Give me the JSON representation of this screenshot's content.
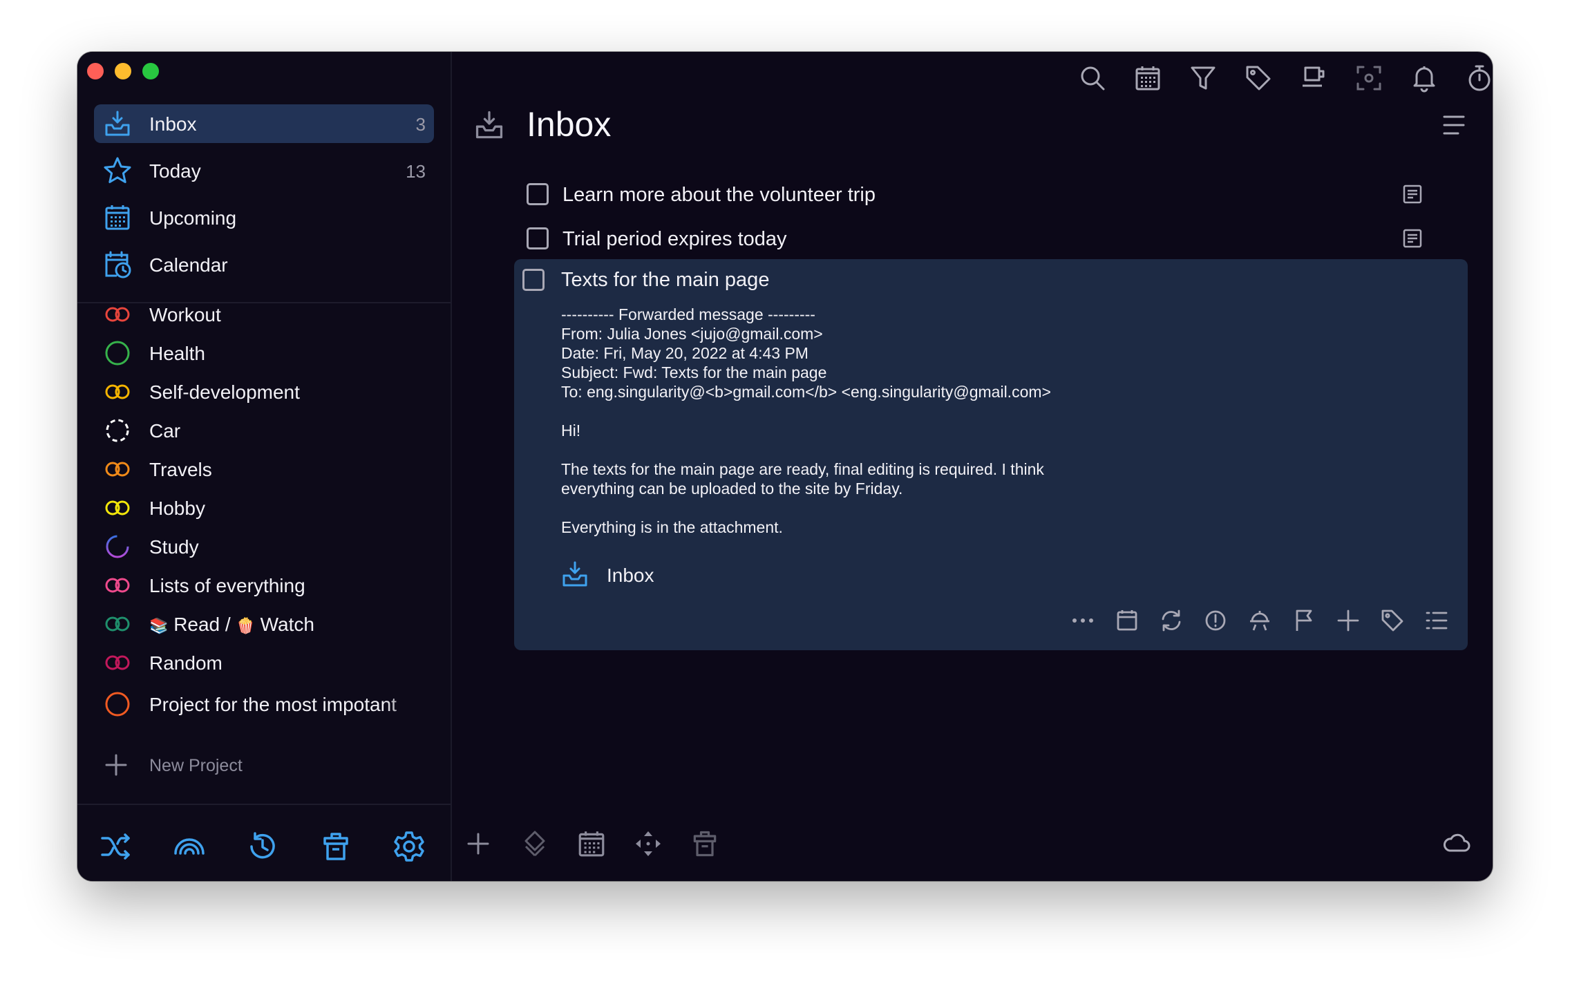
{
  "colors": {
    "accent": "#3fa2ee",
    "window_bg": "#0c0818",
    "selected_bg": "#223356",
    "expanded_task_bg": "#1d2a44"
  },
  "sidebar": {
    "top_items": [
      {
        "label": "Inbox",
        "count": "3",
        "icon": "inbox-icon",
        "selected": true
      },
      {
        "label": "Today",
        "count": "13",
        "icon": "star-icon"
      },
      {
        "label": "Upcoming",
        "count": "",
        "icon": "calendar-grid-icon"
      },
      {
        "label": "Calendar",
        "count": "",
        "icon": "calendar-clock-icon"
      }
    ],
    "projects": [
      {
        "label": "Workout",
        "icon": "double-ring-icon",
        "color": "#e8453c"
      },
      {
        "label": "Health",
        "icon": "circle-icon",
        "color": "#36b24b"
      },
      {
        "label": "Self-development",
        "icon": "double-ring-icon",
        "color": "#f5b400"
      },
      {
        "label": "Car",
        "icon": "dashed-circle-icon",
        "color": "#ffffff"
      },
      {
        "label": "Travels",
        "icon": "double-ring-icon",
        "color": "#f08a19"
      },
      {
        "label": "Hobby",
        "icon": "double-ring-icon",
        "color": "#f2e60a"
      },
      {
        "label": "Study",
        "icon": "gradient-circle-icon",
        "color": "#5b63d6"
      },
      {
        "label": "Lists of everything",
        "icon": "double-ring-icon",
        "color": "#ee4a8c"
      },
      {
        "label": "Read /",
        "label2": "Watch",
        "icon": "double-ring-icon",
        "color": "#1f8f6c",
        "emoji1": "📚",
        "emoji2": "🍿"
      },
      {
        "label": "Random",
        "icon": "double-ring-icon",
        "color": "#c2185b"
      },
      {
        "label": "Project for the most impotant",
        "icon": "circle-icon",
        "color": "#f05a22"
      }
    ],
    "new_project_label": "New Project",
    "bottom_buttons": [
      "shuffle-icon",
      "rainbow-icon",
      "history-icon",
      "trash-icon",
      "settings-icon"
    ]
  },
  "toolbar": {
    "icons": [
      "search-icon",
      "calendar-icon",
      "filter-icon",
      "tag-icon",
      "coffee-icon",
      "focus-icon",
      "bell-icon",
      "stopwatch-icon",
      "copy-icon"
    ]
  },
  "main": {
    "title": "Inbox",
    "tasks": [
      {
        "title": "Learn more about the volunteer trip",
        "has_note": true
      },
      {
        "title": "Trial period expires today",
        "has_note": true
      }
    ],
    "expanded_task": {
      "title": "Texts for the main page",
      "body_lines": [
        "---------- Forwarded message ---------",
        "From: Julia Jones <jujo@gmail.com>",
        "Date: Fri, May 20, 2022 at 4:43 PM",
        "Subject: Fwd: Texts for the main page",
        "To: eng.singularity@<b>gmail.com</b> <eng.singularity@gmail.com>",
        "",
        "Hi!",
        "",
        "The texts for the main page are ready, final editing is required. I think",
        "everything can be uploaded to the site by Friday.",
        "",
        "Everything is in the attachment."
      ],
      "project": "Inbox",
      "actions": [
        "more-icon",
        "date-icon",
        "repeat-icon",
        "priority-icon",
        "reminder-icon",
        "flag-icon",
        "checklist-add-icon",
        "tag-icon",
        "notes-list-icon"
      ]
    },
    "bottom_tools": [
      "add-icon",
      "tag-outline-icon",
      "calendar-icon",
      "move-icon",
      "trash-icon"
    ]
  }
}
